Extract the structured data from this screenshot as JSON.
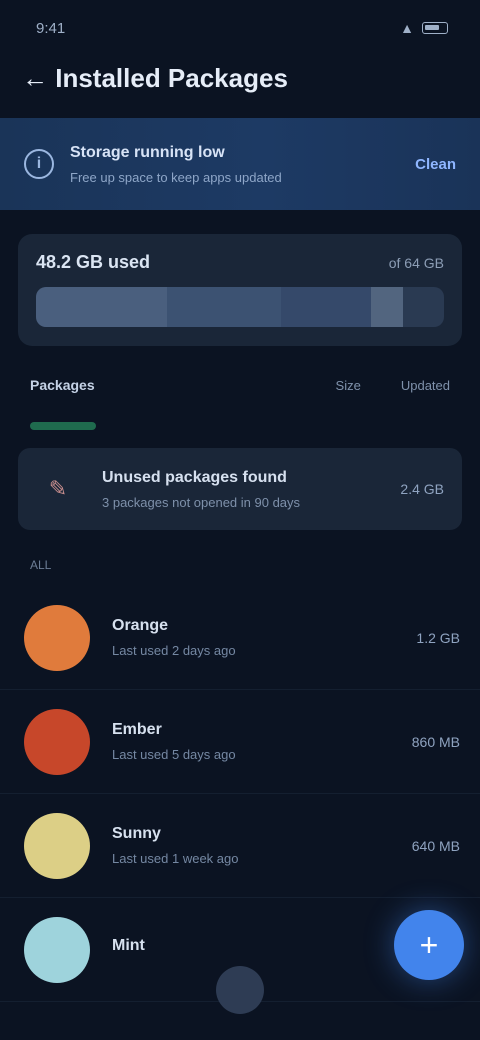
{
  "status": {
    "time": "9:41",
    "signal": "▲",
    "battery": ""
  },
  "header": {
    "title": "← Installed Packages",
    "back": "←"
  },
  "banner": {
    "title": "Storage running low",
    "subtitle": "Free up space to keep apps updated",
    "action": "Clean"
  },
  "storage": {
    "used": "48.2 GB used",
    "total": "of 64 GB",
    "segments": [
      0.32,
      0.28,
      0.22,
      0.08
    ]
  },
  "section": {
    "title": "Packages",
    "meta_a": "Size",
    "meta_b": "Updated"
  },
  "recommendation": {
    "title": "Unused packages found",
    "subtitle": "3 packages not opened in 90 days",
    "size": "2.4 GB",
    "icon": "broom-icon"
  },
  "apps_label": "ALL",
  "apps": [
    {
      "name": "Orange",
      "desc": "Last used 2 days ago",
      "size": "1.2 GB",
      "color": "#e07b3c"
    },
    {
      "name": "Ember",
      "desc": "Last used 5 days ago",
      "size": "860 MB",
      "color": "#c7472a"
    },
    {
      "name": "Sunny",
      "desc": "Last used 1 week ago",
      "size": "640 MB",
      "color": "#dccf86"
    },
    {
      "name": "Mint",
      "desc": "",
      "size": "",
      "color": "#9ed3dc"
    }
  ],
  "fab": {
    "icon": "+"
  }
}
